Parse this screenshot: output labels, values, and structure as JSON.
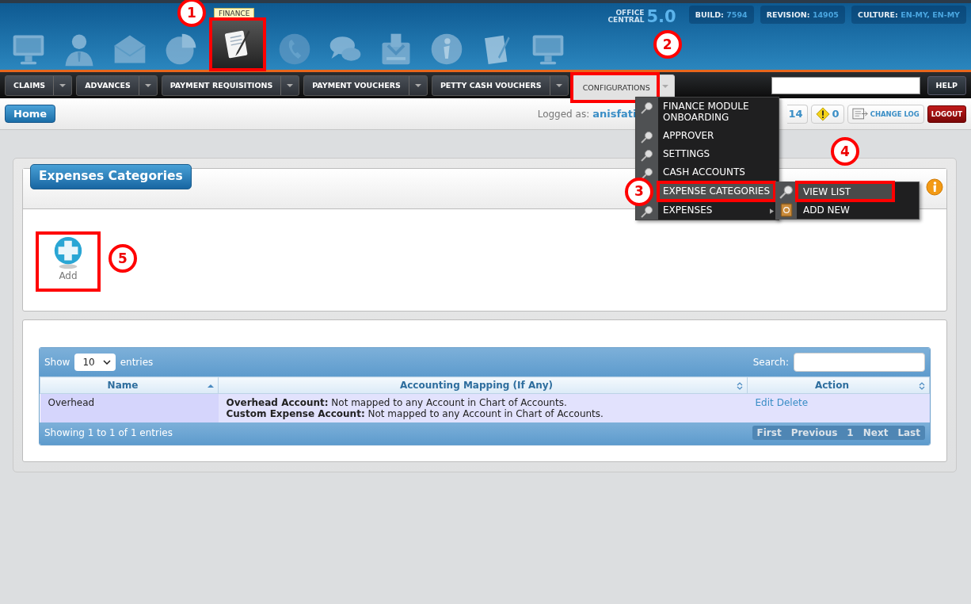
{
  "header": {
    "modules": [
      {
        "kind": "monitor",
        "selected": false
      },
      {
        "kind": "person",
        "selected": false
      },
      {
        "kind": "envelope",
        "selected": false
      },
      {
        "kind": "pie",
        "selected": false
      },
      {
        "kind": "document-pen",
        "selected": true,
        "tooltip": "FINANCE",
        "callout": "1"
      },
      {
        "kind": "phone",
        "selected": false
      },
      {
        "kind": "chat",
        "selected": false
      },
      {
        "kind": "tray",
        "selected": false
      },
      {
        "kind": "info",
        "selected": false
      },
      {
        "kind": "document",
        "selected": false
      },
      {
        "kind": "monitor",
        "selected": false
      }
    ],
    "logo": {
      "line_1": "OFFICE",
      "line_2": "CENTRAL",
      "version": "5.0"
    },
    "badges": [
      {
        "label": "BUILD:",
        "value": "7594"
      },
      {
        "label": "REVISION:",
        "value": "14905"
      },
      {
        "label": "CULTURE:",
        "value": "EN-MY, EN-MY"
      }
    ]
  },
  "nav": {
    "tabs": [
      {
        "label": "CLAIMS",
        "selected": false
      },
      {
        "label": "ADVANCES",
        "selected": false
      },
      {
        "label": "PAYMENT REQUISITIONS",
        "selected": false
      },
      {
        "label": "PAYMENT VOUCHERS",
        "selected": false
      },
      {
        "label": "PETTY CASH VOUCHERS",
        "selected": false
      },
      {
        "label": "CONFIGURATIONS",
        "selected": true,
        "callout": "2"
      }
    ],
    "help": "HELP"
  },
  "subbar": {
    "home": "Home",
    "logged_as_label": "Logged as:",
    "user": "anisfati",
    "messages_count": "14",
    "alerts_count": "0",
    "change_log": "CHANGE LOG",
    "logout": "LOGOUT"
  },
  "menu": {
    "items": [
      {
        "label": "FINANCE MODULE ONBOARDING",
        "selected": false,
        "has_submenu": false
      },
      {
        "label": "APPROVER",
        "selected": false,
        "has_submenu": false
      },
      {
        "label": "SETTINGS",
        "selected": false,
        "has_submenu": false
      },
      {
        "label": "CASH ACCOUNTS",
        "selected": false,
        "has_submenu": false
      },
      {
        "label": "EXPENSE CATEGORIES",
        "selected": true,
        "has_submenu": false,
        "callout": "3",
        "submenu": [
          {
            "label": "VIEW LIST",
            "kind": "search",
            "selected": true,
            "callout": "4"
          },
          {
            "label": "ADD NEW",
            "kind": "address-book",
            "selected": false
          }
        ]
      },
      {
        "label": "EXPENSES",
        "selected": false,
        "has_submenu": true
      }
    ]
  },
  "page": {
    "title": "Expenses Categories",
    "add_button": {
      "label": "Add",
      "callout": "5"
    },
    "table": {
      "show_label": "Show",
      "page_size": "10",
      "entries_label": "entries",
      "search_label": "Search:",
      "columns": [
        {
          "label": "Name",
          "sorted": true
        },
        {
          "label": "Accounting Mapping (If Any)",
          "sorted": false
        },
        {
          "label": "Action",
          "sorted": false
        }
      ],
      "rows": [
        {
          "name": "Overhead",
          "mapping": [
            "**Overhead Account:** Not mapped to any Account in Chart of Accounts.",
            "**Custom Expense Account:** Not mapped to any Account in Chart of Accounts."
          ],
          "actions": [
            "Edit",
            "Delete"
          ]
        }
      ],
      "info": "Showing 1 to 1 of 1 entries",
      "pagination": [
        {
          "label": "First",
          "disabled": true
        },
        {
          "label": "Previous",
          "disabled": true
        },
        {
          "label": "1",
          "disabled": true
        },
        {
          "label": "Next",
          "disabled": true
        },
        {
          "label": "Last",
          "disabled": true
        }
      ]
    }
  }
}
